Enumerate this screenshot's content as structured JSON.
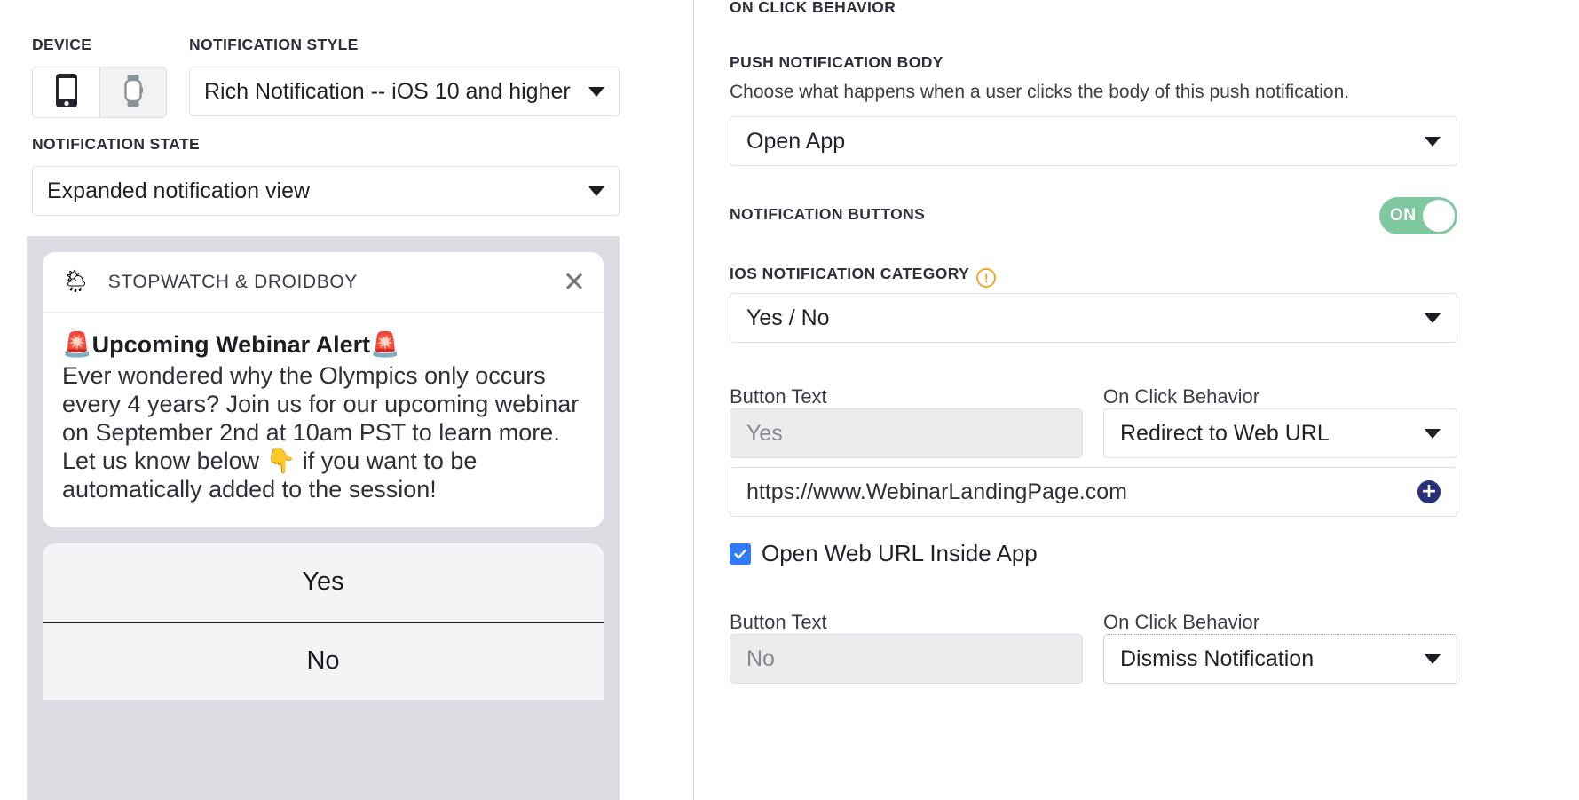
{
  "left": {
    "device": {
      "label": "DEVICE",
      "options": [
        {
          "name": "phone",
          "icon": "phone-icon",
          "selected": true
        },
        {
          "name": "watch",
          "icon": "watch-icon",
          "selected": false
        }
      ]
    },
    "notification_style": {
      "label": "NOTIFICATION STYLE",
      "value": "Rich Notification -- iOS 10 and higher"
    },
    "notification_state": {
      "label": "NOTIFICATION STATE",
      "value": "Expanded notification view"
    },
    "preview": {
      "app_icon": "🌦",
      "app_name": "STOPWATCH & DROIDBOY",
      "close_icon": "✕",
      "title": "🚨Upcoming Webinar Alert🚨",
      "body": "Ever wondered why the Olympics only occurs every 4 years? Join us for our upcoming webinar on September 2nd at 10am PST to learn more. Let us know below 👇 if you want to be automatically added to the session!",
      "actions": [
        "Yes",
        "No"
      ]
    }
  },
  "right": {
    "on_click_behavior_heading": "ON CLICK BEHAVIOR",
    "push_body": {
      "label": "PUSH NOTIFICATION BODY",
      "helper": "Choose what happens when a user clicks the body of this push notification.",
      "value": "Open App"
    },
    "notification_buttons": {
      "label": "NOTIFICATION BUTTONS",
      "toggle_state": "ON"
    },
    "ios_category": {
      "label": "IOS NOTIFICATION CATEGORY",
      "warning_icon": "!",
      "value": "Yes / No"
    },
    "buttons": [
      {
        "button_text_label": "Button Text",
        "button_text_value": "Yes",
        "on_click_label": "On Click Behavior",
        "on_click_value": "Redirect to Web URL",
        "url_value": "https://www.WebinarLandingPage.com",
        "add_icon": "+",
        "checkbox_label": "Open Web URL Inside App",
        "checkbox_checked": true
      },
      {
        "button_text_label": "Button Text",
        "button_text_value": "No",
        "on_click_label": "On Click Behavior",
        "on_click_value": "Dismiss Notification"
      }
    ]
  },
  "colors": {
    "toggle_on": "#7fc8a0",
    "checkbox_blue": "#2f7cf6",
    "warning_orange": "#f0a92c",
    "plus_navy": "#29317a",
    "preview_bg": "#dcdde2"
  }
}
